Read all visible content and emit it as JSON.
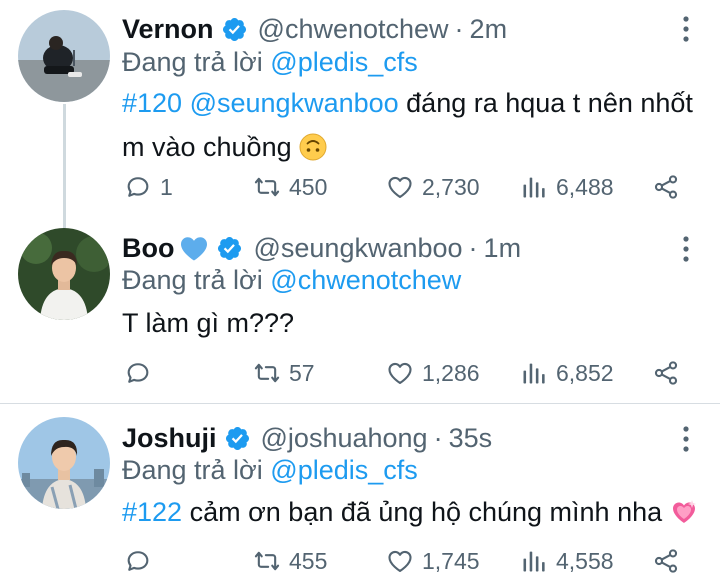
{
  "reply_prefix": "Đang trả lời",
  "tweets": [
    {
      "name": "Vernon",
      "handle": "@chwenotchew",
      "dot": "·",
      "time": "2m",
      "replying_to": "@pledis_cfs",
      "text_link1": "#120",
      "text_link2": "@seungkwanboo",
      "text_rest": " đáng ra hqua t nên nhốt m vào chuồng ",
      "emoji": "upside-down-face",
      "stats": {
        "replies": "1",
        "retweets": "450",
        "likes": "2,730",
        "views": "6,488"
      }
    },
    {
      "name": "Boo",
      "name_emoji": "blue-heart",
      "handle": "@seungkwanboo",
      "dot": "·",
      "time": "1m",
      "replying_to": "@chwenotchew",
      "text": "T làm gì m???",
      "stats": {
        "replies": "",
        "retweets": "57",
        "likes": "1,286",
        "views": "6,852"
      }
    },
    {
      "name": "Joshuji",
      "handle": "@joshuahong",
      "dot": "·",
      "time": "35s",
      "replying_to": "@pledis_cfs",
      "text_link1": "#122",
      "text_rest": " cảm ơn bạn đã ủng hộ chúng mình nha ",
      "emoji": "sparkling-heart",
      "stats": {
        "replies": "",
        "retweets": "455",
        "likes": "1,745",
        "views": "4,558"
      }
    }
  ],
  "colors": {
    "link": "#1d9bf0",
    "verified": "#1d9bf0",
    "muted": "#536471",
    "thread_line": "#cfd9de"
  }
}
